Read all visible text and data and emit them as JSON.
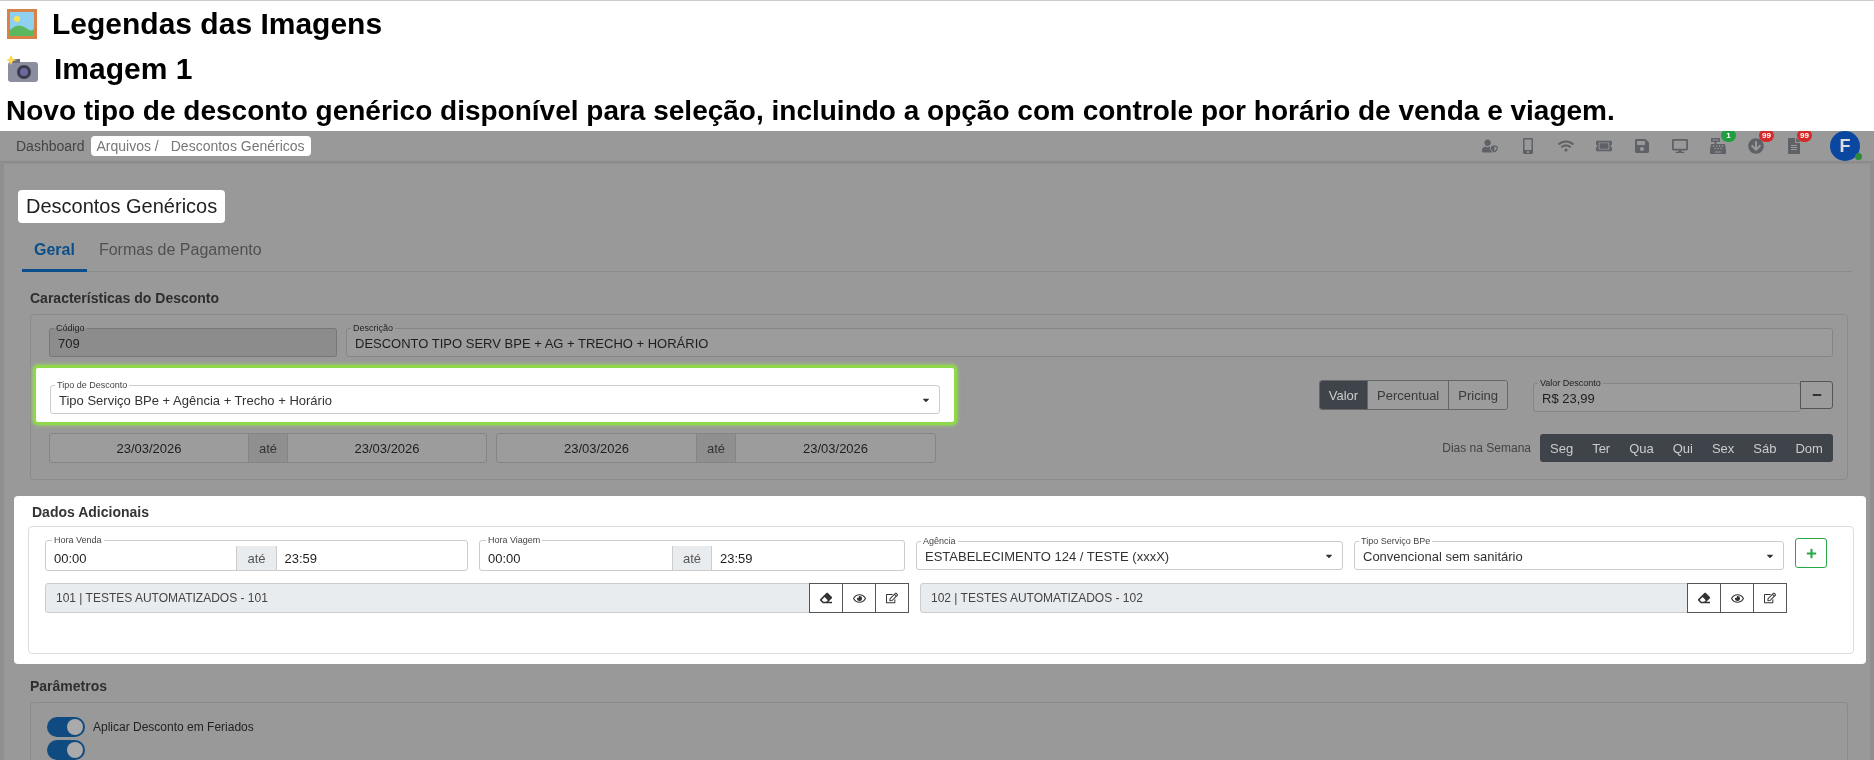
{
  "captions": [
    {
      "kind": "picture",
      "text": "Legendas das Imagens"
    },
    {
      "kind": "camera",
      "text": "Imagem 1"
    },
    {
      "kind": "plain",
      "text": "Novo tipo de desconto genérico disponível para seleção, incluindo a opção com controle por horário de venda e viagem."
    }
  ],
  "breadcrumb": [
    {
      "label": "Dashboard",
      "highlighted": false
    },
    {
      "label": "Arquivos /",
      "highlighted": true
    },
    {
      "label": "Descontos Genéricos",
      "highlighted": true
    }
  ],
  "toolbar": [
    {
      "kind": "user-shield"
    },
    {
      "kind": "phone"
    },
    {
      "kind": "wifi"
    },
    {
      "kind": "ticket"
    },
    {
      "kind": "save"
    },
    {
      "kind": "monitor"
    },
    {
      "kind": "register",
      "badge": "1",
      "color": "#1e9e3e"
    },
    {
      "kind": "download",
      "badge": "99",
      "color": "#d42a2a"
    },
    {
      "kind": "document",
      "badge": "99",
      "color": "#d42a2a"
    }
  ],
  "avatar": {
    "initial": "F",
    "online": true
  },
  "page_title": {
    "text": "Descontos Genéricos",
    "highlighted": true
  },
  "tabs": [
    {
      "label": "Geral",
      "selected": true
    },
    {
      "label": "Formas de Pagamento",
      "selected": false
    }
  ],
  "characteristics": {
    "title": "Características do Desconto",
    "code": {
      "label": "Código",
      "value": "709",
      "disabled": true
    },
    "description": {
      "label": "Descrição",
      "value": "DESCONTO TIPO SERV BPE + AG + TRECHO + HORÁRIO"
    },
    "discount_type": {
      "label": "Tipo de Desconto",
      "value": "Tipo Serviço BPe + Agência + Trecho + Horário",
      "highlighted": true
    },
    "value_modes": [
      {
        "label": "Valor",
        "selected": true
      },
      {
        "label": "Percentual",
        "selected": false
      },
      {
        "label": "Pricing",
        "selected": false
      }
    ],
    "discount_value": {
      "label": "Valor Desconto",
      "value": "R$ 23,99"
    },
    "date_ranges": [
      {
        "from": "23/03/2026",
        "separator": "até",
        "to": "23/03/2026"
      },
      {
        "from": "23/03/2026",
        "separator": "até",
        "to": "23/03/2026"
      }
    ],
    "weekdays_label": "Dias na Semana",
    "weekdays": [
      {
        "label": "Seg",
        "selected": true
      },
      {
        "label": "Ter",
        "selected": true
      },
      {
        "label": "Qua",
        "selected": true
      },
      {
        "label": "Qui",
        "selected": true
      },
      {
        "label": "Sex",
        "selected": true
      },
      {
        "label": "Sáb",
        "selected": true
      },
      {
        "label": "Dom",
        "selected": true
      }
    ]
  },
  "additional": {
    "title": "Dados Adicionais",
    "highlighted": true,
    "time_ranges": [
      {
        "label": "Hora Venda",
        "from": "00:00",
        "separator": "até",
        "to": "23:59"
      },
      {
        "label": "Hora Viagem",
        "from": "00:00",
        "separator": "até",
        "to": "23:59"
      }
    ],
    "agency": {
      "label": "Agência",
      "value": "ESTABELECIMENTO 124 / TESTE (xxxX)"
    },
    "service_type": {
      "label": "Tipo Serviço BPe",
      "value": "Convencional sem sanitário"
    },
    "entries": [
      {
        "text": "101 | TESTES AUTOMATIZADOS - 101"
      },
      {
        "text": "102 | TESTES AUTOMATIZADOS - 102"
      }
    ]
  },
  "parameters": {
    "title": "Parâmetros",
    "toggles": [
      {
        "label": "Aplicar Desconto em Feriados",
        "on": true
      },
      {
        "on": true
      }
    ]
  }
}
